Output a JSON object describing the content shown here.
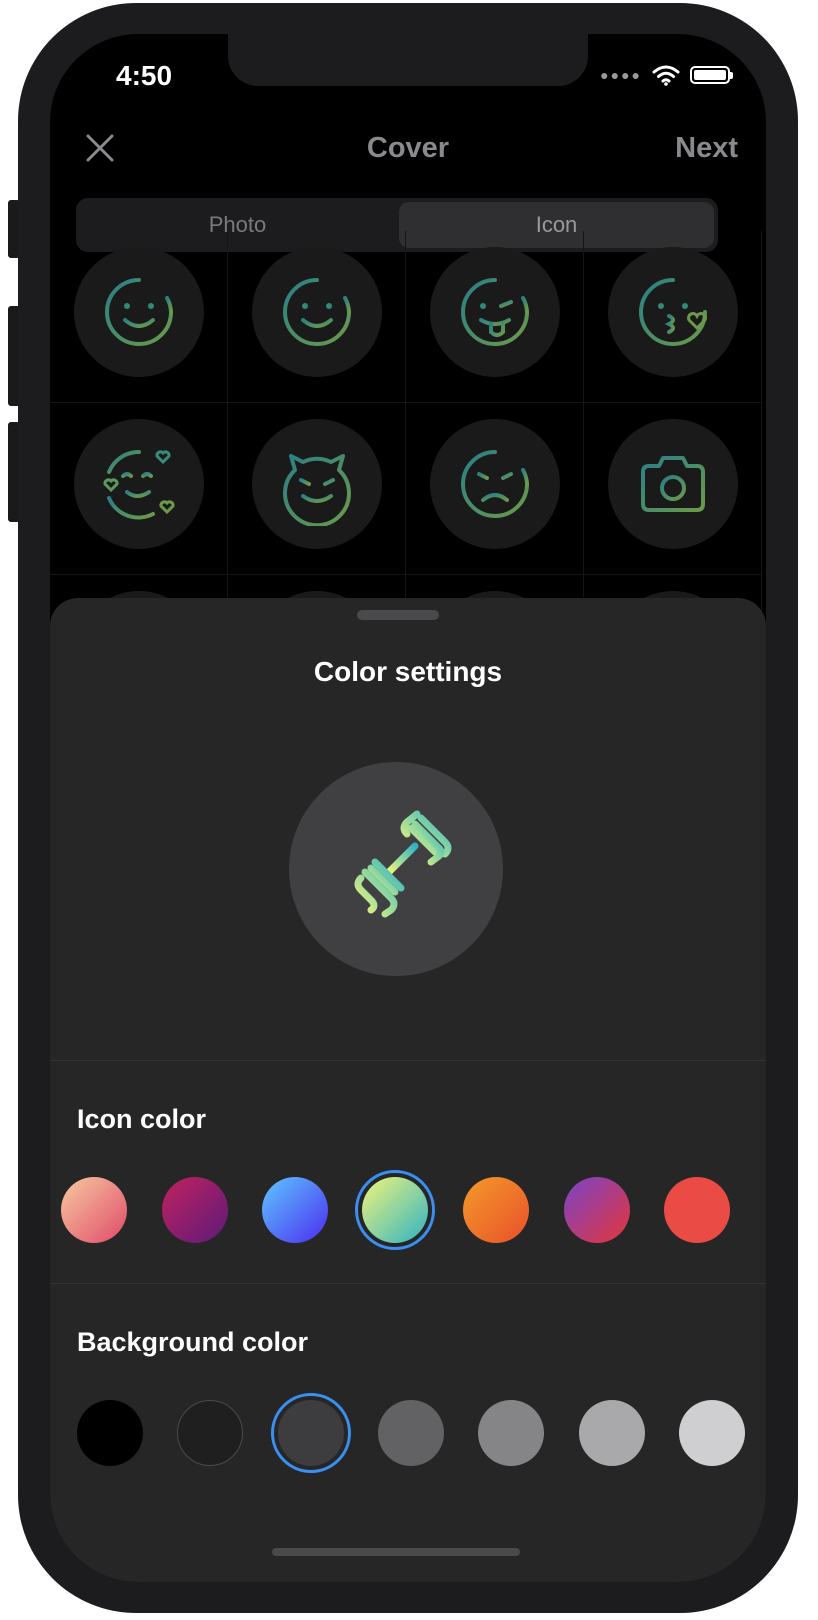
{
  "status_bar": {
    "time": "4:50",
    "signal_icon": "signal-dots-icon",
    "wifi_icon": "wifi-icon",
    "battery_icon": "battery-icon"
  },
  "nav": {
    "close_icon": "close-icon",
    "title": "Cover",
    "next_label": "Next"
  },
  "segmented": {
    "options": [
      "Photo",
      "Icon"
    ],
    "selected": "Icon"
  },
  "icon_grid": {
    "rows": [
      [
        "smile-icon",
        "smile-icon",
        "tongue-wink-icon",
        "kiss-heart-icon"
      ],
      [
        "heart-eyes-icon",
        "devil-icon",
        "angry-icon",
        "camera-icon"
      ]
    ]
  },
  "sheet": {
    "title": "Color settings",
    "preview_icon": "dumbbell-icon",
    "icon_color": {
      "label": "Icon color",
      "swatches": [
        {
          "name": "peach-pink",
          "colors": [
            "#f7caa0",
            "#e04a6a"
          ]
        },
        {
          "name": "magenta-purple",
          "colors": [
            "#c2225e",
            "#5b1a7a"
          ]
        },
        {
          "name": "blue-indigo",
          "colors": [
            "#5fc8ff",
            "#4a2cf0"
          ]
        },
        {
          "name": "lime-teal",
          "colors": [
            "#f2f57a",
            "#2fb3c2"
          ]
        },
        {
          "name": "orange",
          "colors": [
            "#f59a2a",
            "#e8502a"
          ]
        },
        {
          "name": "red-violet",
          "colors": [
            "#7a44c8",
            "#e4353a"
          ]
        },
        {
          "name": "red",
          "colors": [
            "#ea4b45",
            "#ea4b45"
          ]
        }
      ],
      "selected_index": 3
    },
    "background_color": {
      "label": "Background color",
      "swatches": [
        "#000000",
        "#1f1f20",
        "#3d3d3f",
        "#626264",
        "#858587",
        "#a9a9ab",
        "#cfcfd1"
      ],
      "selected_index": 2
    }
  }
}
